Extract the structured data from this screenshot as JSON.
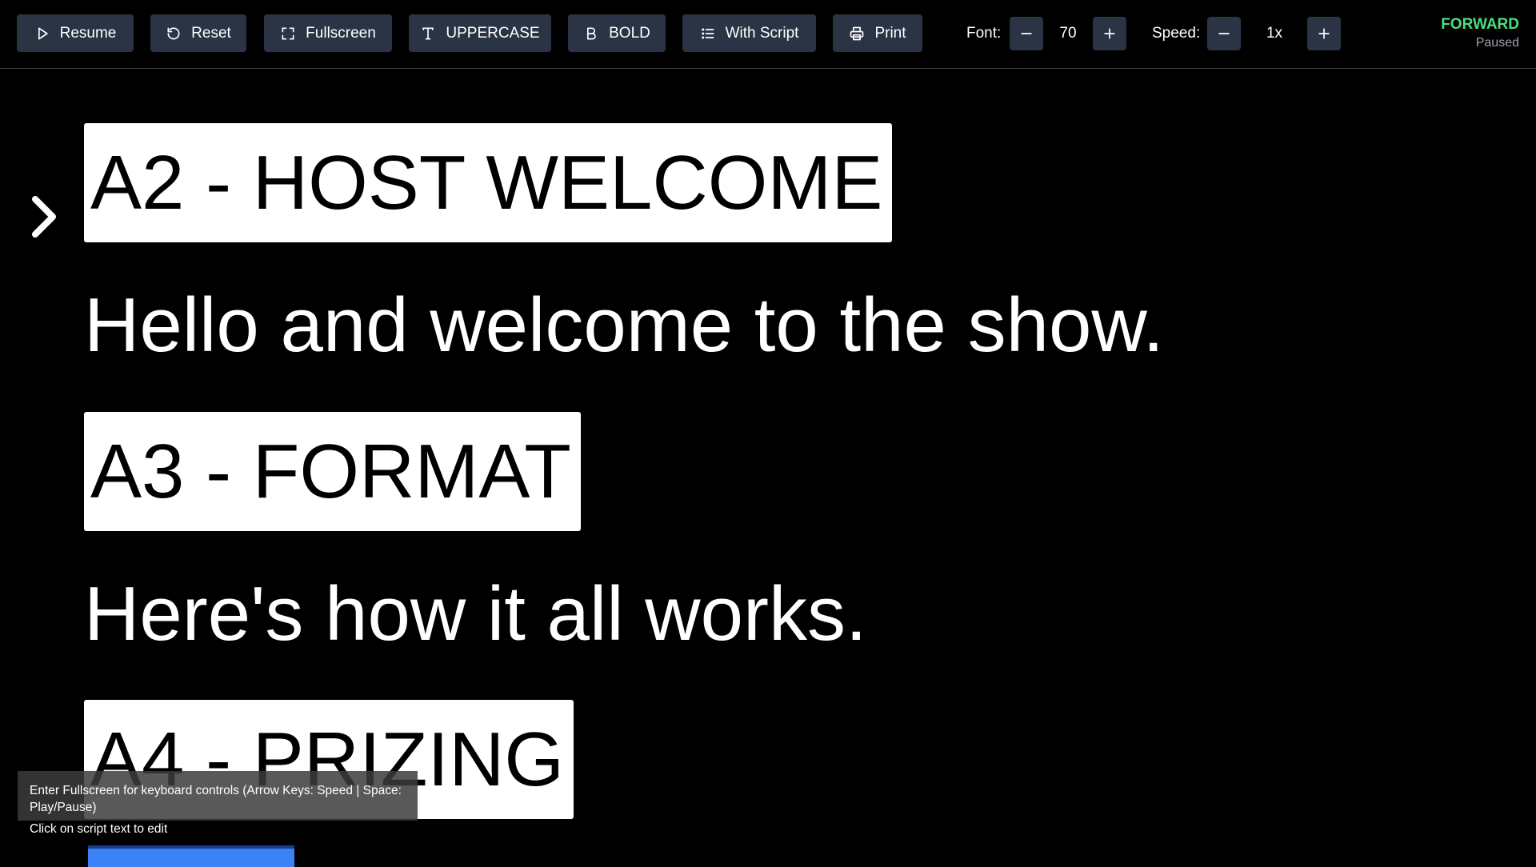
{
  "toolbar": {
    "resume_label": "Resume",
    "reset_label": "Reset",
    "fullscreen_label": "Fullscreen",
    "uppercase_label": "UPPERCASE",
    "bold_label": "BOLD",
    "with_script_label": "With Script",
    "print_label": "Print",
    "font_label": "Font:",
    "font_value": "70",
    "speed_label": "Speed:",
    "speed_value": "1x"
  },
  "status": {
    "direction": "FORWARD",
    "state": "Paused",
    "direction_color": "#4ade80"
  },
  "script": {
    "items": [
      {
        "kind": "heading",
        "text": "A2 - HOST WELCOME"
      },
      {
        "kind": "line",
        "text": "Hello and welcome to the show."
      },
      {
        "kind": "heading",
        "text": "A3 - FORMAT"
      },
      {
        "kind": "line",
        "text": "Here's how it all works."
      },
      {
        "kind": "heading",
        "text": "A4 - PRIZING"
      }
    ]
  },
  "hint": {
    "keyboard": "Enter Fullscreen for keyboard controls (Arrow Keys: Speed | Space: Play/Pause)",
    "edit": "Click on script text to edit"
  },
  "icons": {
    "resume": "play-icon",
    "reset": "reset-icon",
    "fullscreen": "fullscreen-icon",
    "uppercase": "text-type-icon",
    "bold": "bold-icon",
    "with_script": "list-icon",
    "print": "printer-icon",
    "cue": "chevron-right-icon"
  },
  "colors": {
    "button_bg": "#2a3444",
    "accent_blue": "#3b82f6"
  }
}
